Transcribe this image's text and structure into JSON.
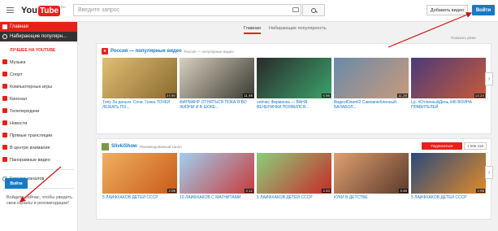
{
  "header": {
    "logo_you": "You",
    "logo_tube": "Tube",
    "logo_region": "RU",
    "search_placeholder": "Введите запрос",
    "upload_label": "Добавить видео",
    "signin_label": "Войти"
  },
  "sidebar": {
    "main": "Главная",
    "recommended": "Набирающие популярн...",
    "section_title": "ЛУЧШЕЕ НА YOUTUBE",
    "categories": [
      "Музыка",
      "Спорт",
      "Компьютерные игры",
      "Кинозал",
      "Телепередачи",
      "Новости",
      "Прямые трансляции",
      "В центре внимания",
      "Панорамные видео"
    ],
    "catalog": "Каталог каналов",
    "signin_text": "Войдите сейчас, чтобы увидеть свои каналы и рекомендации!",
    "signin_button": "Войти"
  },
  "tabs": [
    "Главная",
    "Набирающие популярность"
  ],
  "hide_link": "Показать реже",
  "shelf1": {
    "title": "Россия — популярные видео",
    "subtitle": "Россия — популярные видео",
    "videos": [
      {
        "title": "Типу За деньги. Сочи. Гонка ТОЧКИ ЛЕЖАТЬ ПО...",
        "duration": "24:50",
        "color": "#c8a24a"
      },
      {
        "title": "ФИРМАНР ОТНЯТЬСЯ ПОКА Я ВО ЖИЗНИ И В ШОКЕ...",
        "duration": "11:48",
        "color": "#5a5a4a"
      },
      {
        "title": "сейчас Фирманка — ВАНЯ ВЕЧЕРИНКИ ПОЯВИЛСЯ...",
        "duration": "6:56",
        "color": "#3aa36a"
      },
      {
        "title": "ВидеоЮлия#2 Самовлюбленный БАЛАБОЛ...",
        "duration": "11:28",
        "color": "#4a6a8a"
      },
      {
        "title": "Lp. #ОтличныйДень #46 ВОЙНА ПРАВИТЕЛЕЙ",
        "duration": "14:24",
        "color": "#7a5a9a"
      }
    ]
  },
  "shelf2": {
    "title": "SlivkiShow",
    "subtitle": "Рекомендованный канал",
    "subscribe_label": "Подписаться",
    "sub_count": "1 566 418",
    "videos": [
      {
        "title": "5 ЛАЙФХАКОВ ДЕТЕЙ СССР",
        "duration": "3:06",
        "color": "#d88a2a"
      },
      {
        "title": "10 ЛАЙФХАКОВ С МАГНИТАМИ",
        "duration": "3:12",
        "color": "#5aa0d8"
      },
      {
        "title": "5 ЛАЙФХАКОВ ДЕТЕЙ СССР",
        "duration": "3:33",
        "color": "#4ab06a"
      },
      {
        "title": "КУКИ В ДЕТСТВЕ",
        "duration": "3:46",
        "color": "#c86a3a"
      },
      {
        "title": "5 ЛАЙФХАКОВ ДЕТЕЙ СССР",
        "duration": "3:08",
        "color": "#3a5a8a"
      }
    ]
  },
  "colors": {
    "brand": "#e62117",
    "link": "#167ac6"
  }
}
